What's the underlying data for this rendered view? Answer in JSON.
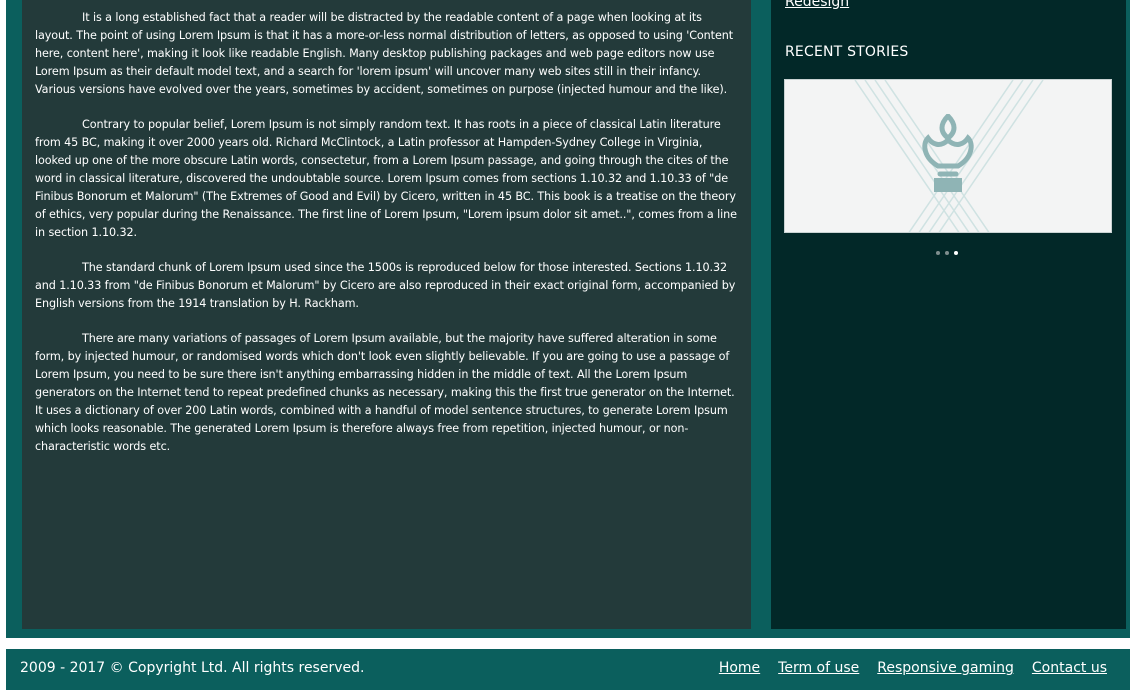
{
  "main": {
    "paragraphs": [
      "It is a long established fact that a reader will be distracted by the readable content of a page when looking at its layout. The point of using Lorem Ipsum is that it has a more-or-less normal distribution of letters, as opposed to using 'Content here, content here', making it look like readable English. Many desktop publishing packages and web page editors now use Lorem Ipsum as their default model text, and a search for 'lorem ipsum' will uncover many web sites still in their infancy. Various versions have evolved over the years, sometimes by accident, sometimes on purpose (injected humour and the like).",
      "Contrary to popular belief, Lorem Ipsum is not simply random text. It has roots in a piece of classical Latin literature from 45 BC, making it over 2000 years old. Richard McClintock, a Latin professor at Hampden-Sydney College in Virginia, looked up one of the more obscure Latin words, consectetur, from a Lorem Ipsum passage, and going through the cites of the word in classical literature, discovered the undoubtable source. Lorem Ipsum comes from sections 1.10.32 and 1.10.33 of \"de Finibus Bonorum et Malorum\" (The Extremes of Good and Evil) by Cicero, written in 45 BC. This book is a treatise on the theory of ethics, very popular during the Renaissance. The first line of Lorem Ipsum, \"Lorem ipsum dolor sit amet..\", comes from a line in section 1.10.32.",
      "The standard chunk of Lorem Ipsum used since the 1500s is reproduced below for those interested. Sections 1.10.32 and 1.10.33 from \"de Finibus Bonorum et Malorum\" by Cicero are also reproduced in their exact original form, accompanied by English versions from the 1914 translation by H. Rackham.",
      "There are many variations of passages of Lorem Ipsum available, but the majority have suffered alteration in some form, by injected humour, or randomised words which don't look even slightly believable. If you are going to use a passage of Lorem Ipsum, you need to be sure there isn't anything embarrassing hidden in the middle of text. All the Lorem Ipsum generators on the Internet tend to repeat predefined chunks as necessary, making this the first true generator on the Internet. It uses a dictionary of over 200 Latin words, combined with a handful of model sentence structures, to generate Lorem Ipsum which looks reasonable. The generated Lorem Ipsum is therefore always free from repetition, injected humour, or non-characteristic words etc."
    ]
  },
  "sidebar": {
    "prev_link": "Redesign",
    "recent_title": "RECENT STORIES",
    "slide_icon": "crown-logo-icon",
    "carousel": {
      "count": 3,
      "active_index": 3
    }
  },
  "footer": {
    "copyright": "2009 - 2017 © Copyright Ltd. All rights reserved.",
    "links": [
      "Home",
      "Term of use",
      "Responsive gaming",
      "Contact us"
    ]
  },
  "colors": {
    "frame": "#0b5f5d",
    "main_bg": "#233a3a",
    "sidebar_bg": "#022828",
    "footer_bg": "#0b5f5d"
  }
}
